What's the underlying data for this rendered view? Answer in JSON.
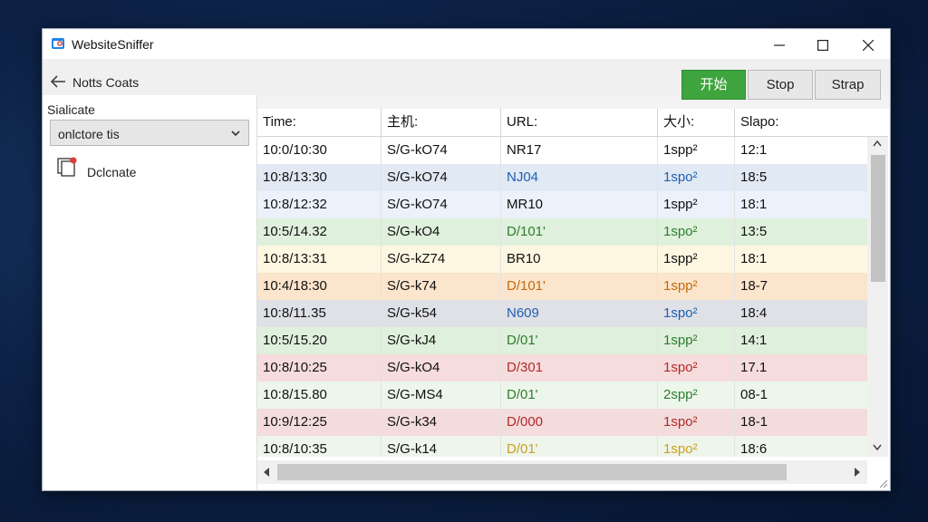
{
  "window": {
    "title": "WebsiteSniffer"
  },
  "toolbar": {
    "back_label": "Notts Coats",
    "start_label": "开始",
    "stop_label": "Stop",
    "strap_label": "Strap"
  },
  "sidebar": {
    "label": "Sialicate",
    "select_value": "onlctore tis",
    "item_label": "Dclcnate"
  },
  "table": {
    "columns": [
      "Time:",
      "主机:",
      "URL:",
      "大小:",
      "Slapo:"
    ],
    "rows": [
      {
        "cells": [
          "10:0/10:30",
          "S/G-kO74",
          "NR17",
          "1spp²",
          "12:1"
        ],
        "bg": "#ffffff",
        "fg": "#111111"
      },
      {
        "cells": [
          "10:8/13:30",
          "S/G-kO74",
          "NJ04",
          "1spo²",
          "18:5"
        ],
        "bg": "#e1e9f4",
        "fg": "#1f5fb0"
      },
      {
        "cells": [
          "10:8/12:32",
          "S/G-kO74",
          "MR10",
          "1spp²",
          "18:1"
        ],
        "bg": "#ebf2fb",
        "fg": "#111111"
      },
      {
        "cells": [
          "10:5/14.32",
          "S/G-kO4",
          "D/101'",
          "1spo²",
          "13:5"
        ],
        "bg": "#dff0dc",
        "fg": "#2e7d2e"
      },
      {
        "cells": [
          "10:8/13:31",
          "S/G-kZ74",
          "BR10",
          "1spp²",
          "18:1"
        ],
        "bg": "#fdf7e2",
        "fg": "#111111"
      },
      {
        "cells": [
          "10:4/18:30",
          "S/G-k74",
          "D/101'",
          "1spp²",
          "18-7"
        ],
        "bg": "#fbe5cc",
        "fg": "#c06a10"
      },
      {
        "cells": [
          "10:8/11.35",
          "S/G-k54",
          "N609",
          "1spo²",
          "18:4"
        ],
        "bg": "#dfe1e7",
        "fg": "#1f5fb0"
      },
      {
        "cells": [
          "10:5/15.20",
          "S/G-kJ4",
          "D/01'",
          "1spp²",
          "14:1"
        ],
        "bg": "#dff0dc",
        "fg": "#2e7d2e"
      },
      {
        "cells": [
          "10:8/10:25",
          "S/G-kO4",
          "D/301",
          "1spo²",
          "17.1"
        ],
        "bg": "#f6dcdc",
        "fg": "#b02a2a"
      },
      {
        "cells": [
          "10:8/15.80",
          "S/G-MS4",
          "D/01'",
          "2spp²",
          "08-1"
        ],
        "bg": "#edf6eb",
        "fg": "#2e7d2e"
      },
      {
        "cells": [
          "10:9/12:25",
          "S/G-k34",
          "D/000",
          "1spo²",
          "18-1"
        ],
        "bg": "#f4dcdc",
        "fg": "#b02a2a"
      },
      {
        "cells": [
          "10:8/10:35",
          "S/G-k14",
          "D/01'",
          "1spo²",
          "18:6"
        ],
        "bg": "#eef5ea",
        "fg": "#c8a020"
      }
    ]
  }
}
